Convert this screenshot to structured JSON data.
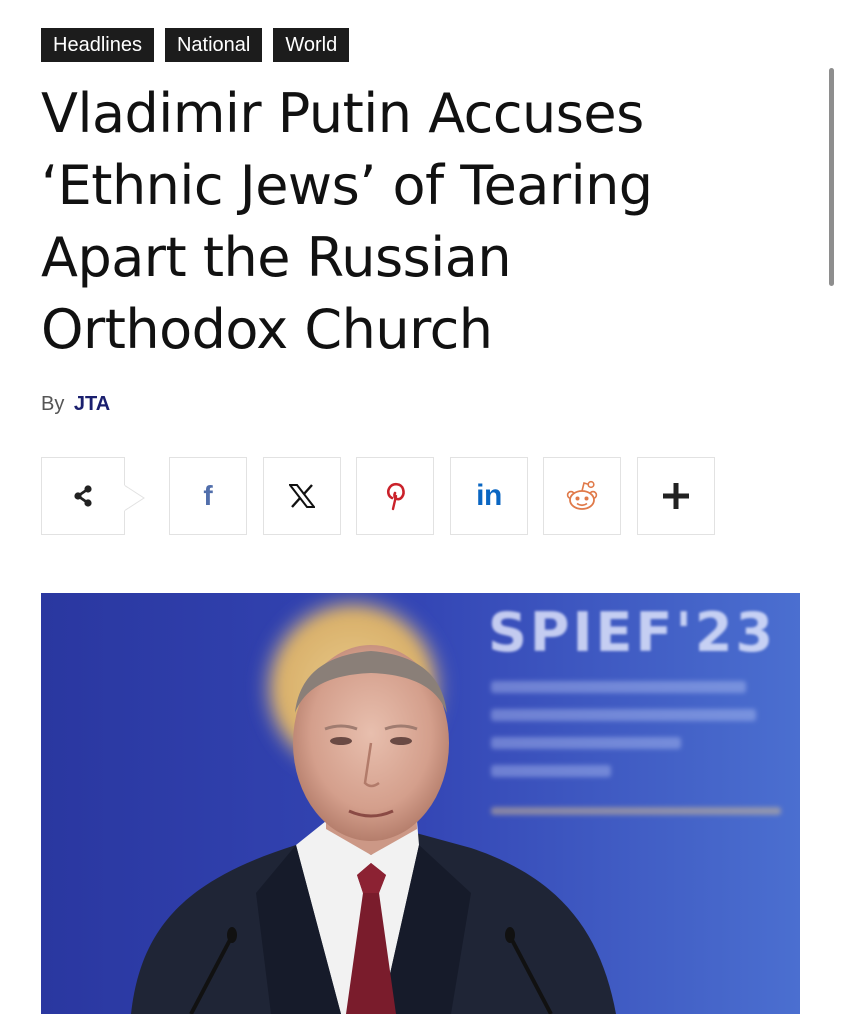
{
  "tags": [
    "Headlines",
    "National",
    "World"
  ],
  "headline": {
    "line1": "Vladimir Putin Accuses",
    "line2": "‘Ethnic Jews’ of Tearing",
    "line3": "Apart the Russian",
    "line4": "Orthodox Church"
  },
  "byline": {
    "prefix": "By",
    "author": "JTA"
  },
  "share": {
    "buttons": [
      {
        "name": "share",
        "icon": "share-icon"
      },
      {
        "name": "facebook",
        "icon": "facebook-icon",
        "label": "f"
      },
      {
        "name": "x",
        "icon": "x-icon"
      },
      {
        "name": "pinterest",
        "icon": "pinterest-icon"
      },
      {
        "name": "linkedin",
        "icon": "linkedin-icon",
        "label": "in"
      },
      {
        "name": "reddit",
        "icon": "reddit-icon"
      },
      {
        "name": "more",
        "icon": "plus-icon"
      }
    ]
  },
  "photo": {
    "backdrop_text": "SPIEF'23"
  },
  "colors": {
    "tag_bg": "#1c1c1c",
    "author": "#1a1f6e",
    "facebook": "#516eab",
    "pinterest": "#ca212a",
    "linkedin": "#0a66c2",
    "reddit": "#ff4500",
    "photo_bg": "#2e3fae"
  }
}
